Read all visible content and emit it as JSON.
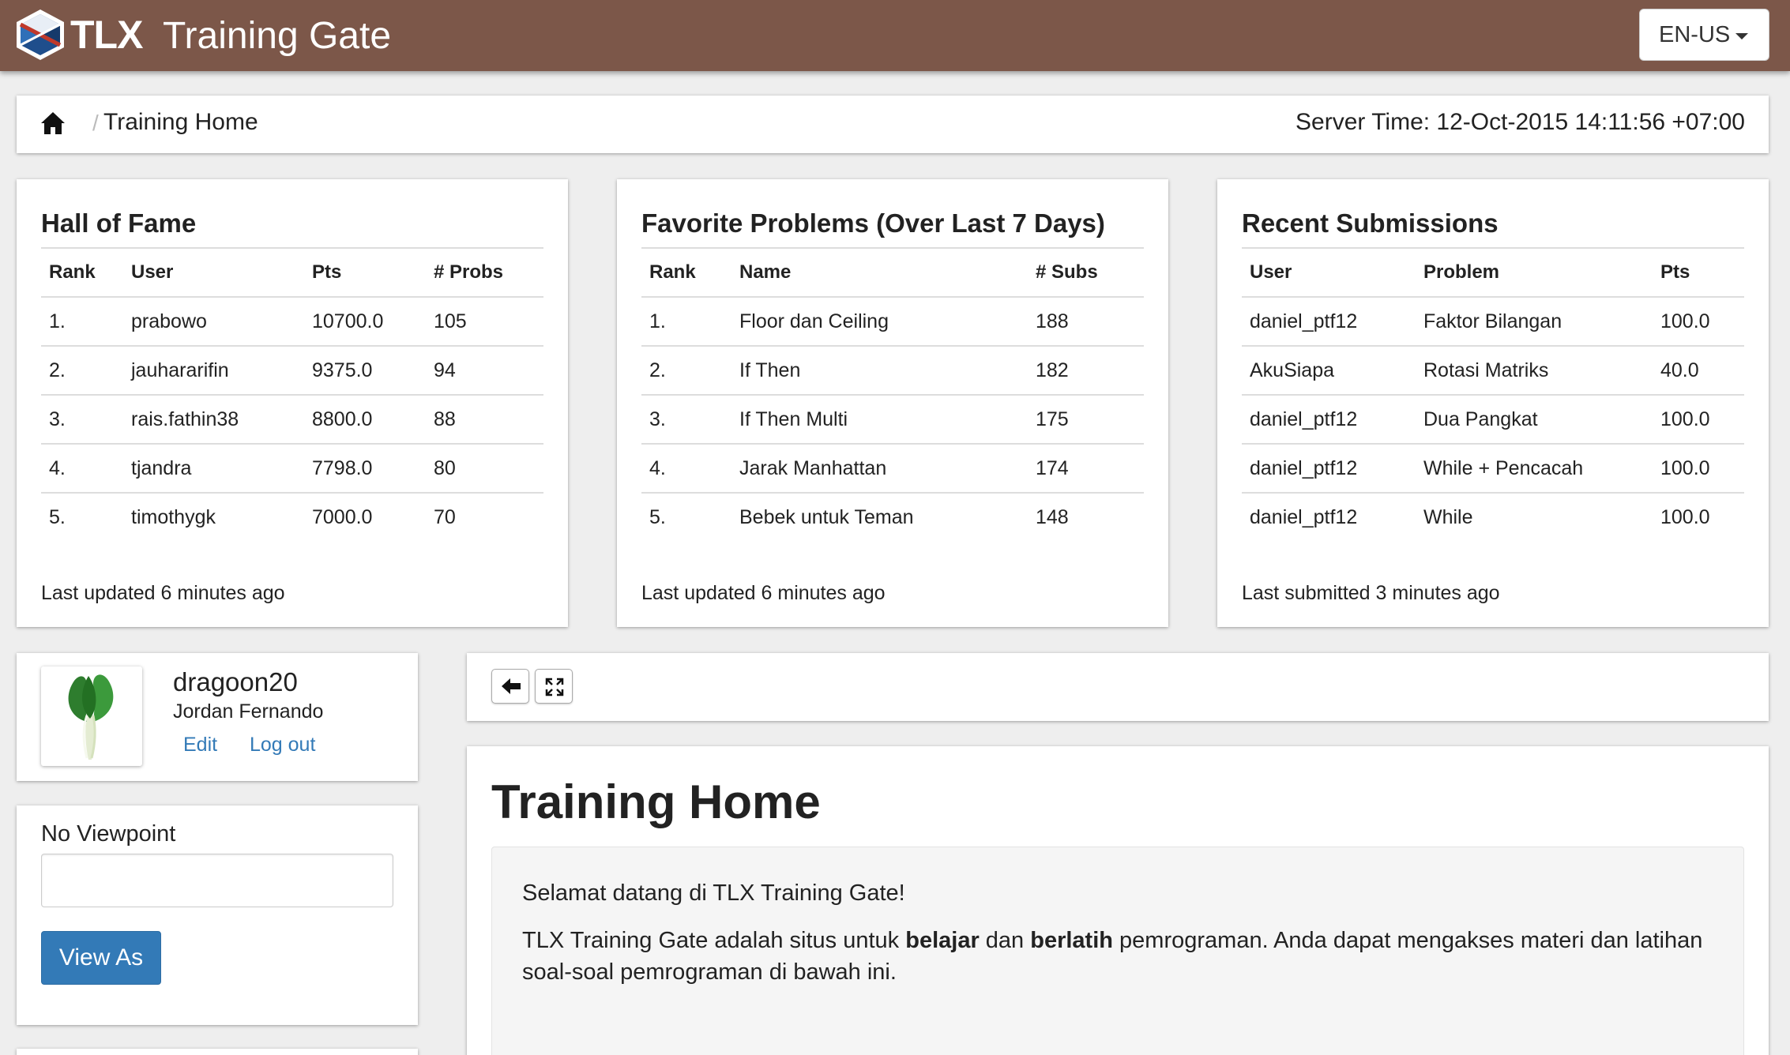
{
  "navbar": {
    "brand_short": "TLX",
    "brand_name": "Training Gate",
    "language": "EN-US",
    "logo_icon": "tlx-logo-icon",
    "color": "#7c5749"
  },
  "breadcrumb": {
    "separator": "/",
    "current": "Training Home",
    "server_time": "Server Time: 12-Oct-2015 14:11:56 +07:00"
  },
  "hall_of_fame": {
    "title": "Hall of Fame",
    "headers": [
      "Rank",
      "User",
      "Pts",
      "# Probs"
    ],
    "rows": [
      [
        "1.",
        "prabowo",
        "10700.0",
        "105"
      ],
      [
        "2.",
        "jauhararifin",
        "9375.0",
        "94"
      ],
      [
        "3.",
        "rais.fathin38",
        "8800.0",
        "88"
      ],
      [
        "4.",
        "tjandra",
        "7798.0",
        "80"
      ],
      [
        "5.",
        "timothygk",
        "7000.0",
        "70"
      ]
    ],
    "footer": "Last updated 6 minutes ago"
  },
  "favorite_problems": {
    "title": "Favorite Problems (Over Last 7 Days)",
    "headers": [
      "Rank",
      "Name",
      "# Subs"
    ],
    "rows": [
      [
        "1.",
        "Floor dan Ceiling",
        "188"
      ],
      [
        "2.",
        "If Then",
        "182"
      ],
      [
        "3.",
        "If Then Multi",
        "175"
      ],
      [
        "4.",
        "Jarak Manhattan",
        "174"
      ],
      [
        "5.",
        "Bebek untuk Teman",
        "148"
      ]
    ],
    "footer": "Last updated 6 minutes ago"
  },
  "recent_submissions": {
    "title": "Recent Submissions",
    "headers": [
      "User",
      "Problem",
      "Pts"
    ],
    "rows": [
      [
        "daniel_ptf12",
        "Faktor Bilangan",
        "100.0"
      ],
      [
        "AkuSiapa",
        "Rotasi Matriks",
        "40.0"
      ],
      [
        "daniel_ptf12",
        "Dua Pangkat",
        "100.0"
      ],
      [
        "daniel_ptf12",
        "While + Pencacah",
        "100.0"
      ],
      [
        "daniel_ptf12",
        "While",
        "100.0"
      ]
    ],
    "footer": "Last submitted 3 minutes ago"
  },
  "user": {
    "username": "dragoon20",
    "name": "Jordan Fernando",
    "edit_label": "Edit",
    "logout_label": "Log out"
  },
  "viewpoint": {
    "label": "No Viewpoint",
    "input_value": "",
    "button_label": "View As"
  },
  "content": {
    "title": "Training Home",
    "greeting": "Selamat datang di TLX Training Gate!",
    "desc_1": "TLX Training Gate adalah situs untuk ",
    "bold_1": "belajar",
    "desc_2": " dan ",
    "bold_2": "berlatih",
    "desc_3": " pemrograman. Anda dapat mengakses materi dan latihan soal-soal pemrograman di bawah ini."
  }
}
